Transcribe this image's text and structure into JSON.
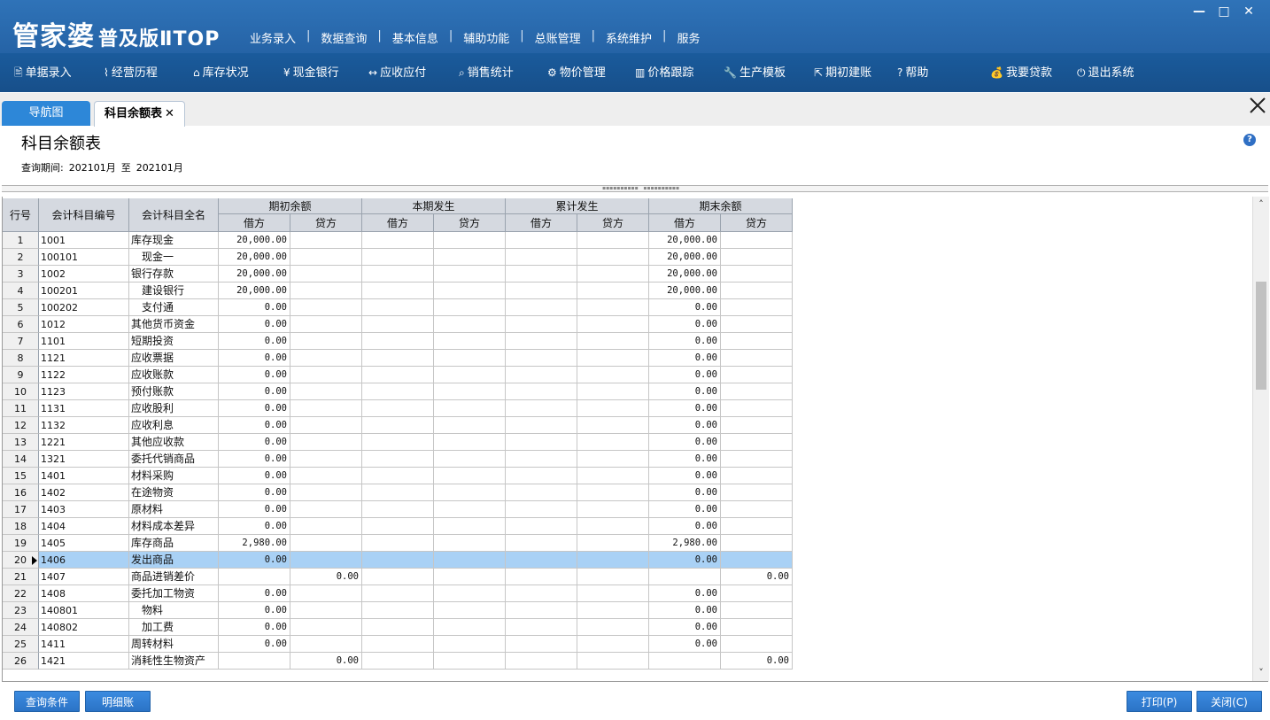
{
  "app": {
    "logo_main": "管家婆",
    "logo_sub": "普及版ⅡTOP"
  },
  "top_menu": [
    "业务录入",
    "数据查询",
    "基本信息",
    "辅助功能",
    "总账管理",
    "系统维护",
    "服务"
  ],
  "window_controls": {
    "minimize": "—",
    "maximize": "□",
    "close": "✕"
  },
  "toolbar": [
    {
      "icon": "document-icon",
      "glyph": "🖹",
      "label": "单据录入"
    },
    {
      "icon": "chart-line-icon",
      "glyph": "⌇",
      "label": "经营历程"
    },
    {
      "icon": "warehouse-icon",
      "glyph": "⌂",
      "label": "库存状况"
    },
    {
      "icon": "yen-icon",
      "glyph": "¥",
      "label": "现金银行"
    },
    {
      "icon": "arrows-icon",
      "glyph": "↔",
      "label": "应收应付"
    },
    {
      "icon": "search-icon",
      "glyph": "⌕",
      "label": "销售统计"
    },
    {
      "icon": "gear-icon",
      "glyph": "⚙",
      "label": "物价管理"
    },
    {
      "icon": "bar-chart-icon",
      "glyph": "▥",
      "label": "价格跟踪"
    },
    {
      "icon": "wrench-icon",
      "glyph": "🔧",
      "label": "生产模板"
    },
    {
      "icon": "export-icon",
      "glyph": "⇱",
      "label": "期初建账"
    },
    {
      "icon": "help-icon",
      "glyph": "?",
      "label": "帮助"
    },
    {
      "icon": "money-bag-icon",
      "glyph": "💰",
      "label": "我要贷款"
    },
    {
      "icon": "power-icon",
      "glyph": "⏻",
      "label": "退出系统"
    }
  ],
  "tabs": {
    "nav": "导航图",
    "current": "科目余额表",
    "close_glyph": "✕"
  },
  "page": {
    "title": "科目余额表",
    "period_label": "查询期间:",
    "period_from": "202101月",
    "period_to_word": "至",
    "period_to": "202101月",
    "help_glyph": "?"
  },
  "grid": {
    "headers": {
      "row_no": "行号",
      "code": "会计科目编号",
      "name": "会计科目全名",
      "groups": [
        "期初余额",
        "本期发生",
        "累计发生",
        "期末余额"
      ],
      "debit": "借方",
      "credit": "贷方"
    },
    "selected_row": 19,
    "rows": [
      {
        "no": "1",
        "code": "1001",
        "name": "库存现金",
        "ob_d": "20,000.00",
        "ob_c": "",
        "cp_d": "",
        "cp_c": "",
        "cu_d": "",
        "cu_c": "",
        "eb_d": "20,000.00",
        "eb_c": ""
      },
      {
        "no": "2",
        "code": "100101",
        "name": "　现金一",
        "ob_d": "20,000.00",
        "ob_c": "",
        "cp_d": "",
        "cp_c": "",
        "cu_d": "",
        "cu_c": "",
        "eb_d": "20,000.00",
        "eb_c": ""
      },
      {
        "no": "3",
        "code": "1002",
        "name": "银行存款",
        "ob_d": "20,000.00",
        "ob_c": "",
        "cp_d": "",
        "cp_c": "",
        "cu_d": "",
        "cu_c": "",
        "eb_d": "20,000.00",
        "eb_c": ""
      },
      {
        "no": "4",
        "code": "100201",
        "name": "　建设银行",
        "ob_d": "20,000.00",
        "ob_c": "",
        "cp_d": "",
        "cp_c": "",
        "cu_d": "",
        "cu_c": "",
        "eb_d": "20,000.00",
        "eb_c": ""
      },
      {
        "no": "5",
        "code": "100202",
        "name": "　支付通",
        "ob_d": "0.00",
        "ob_c": "",
        "cp_d": "",
        "cp_c": "",
        "cu_d": "",
        "cu_c": "",
        "eb_d": "0.00",
        "eb_c": ""
      },
      {
        "no": "6",
        "code": "1012",
        "name": "其他货币资金",
        "ob_d": "0.00",
        "ob_c": "",
        "cp_d": "",
        "cp_c": "",
        "cu_d": "",
        "cu_c": "",
        "eb_d": "0.00",
        "eb_c": ""
      },
      {
        "no": "7",
        "code": "1101",
        "name": "短期投资",
        "ob_d": "0.00",
        "ob_c": "",
        "cp_d": "",
        "cp_c": "",
        "cu_d": "",
        "cu_c": "",
        "eb_d": "0.00",
        "eb_c": ""
      },
      {
        "no": "8",
        "code": "1121",
        "name": "应收票据",
        "ob_d": "0.00",
        "ob_c": "",
        "cp_d": "",
        "cp_c": "",
        "cu_d": "",
        "cu_c": "",
        "eb_d": "0.00",
        "eb_c": ""
      },
      {
        "no": "9",
        "code": "1122",
        "name": "应收账款",
        "ob_d": "0.00",
        "ob_c": "",
        "cp_d": "",
        "cp_c": "",
        "cu_d": "",
        "cu_c": "",
        "eb_d": "0.00",
        "eb_c": ""
      },
      {
        "no": "10",
        "code": "1123",
        "name": "预付账款",
        "ob_d": "0.00",
        "ob_c": "",
        "cp_d": "",
        "cp_c": "",
        "cu_d": "",
        "cu_c": "",
        "eb_d": "0.00",
        "eb_c": ""
      },
      {
        "no": "11",
        "code": "1131",
        "name": "应收股利",
        "ob_d": "0.00",
        "ob_c": "",
        "cp_d": "",
        "cp_c": "",
        "cu_d": "",
        "cu_c": "",
        "eb_d": "0.00",
        "eb_c": ""
      },
      {
        "no": "12",
        "code": "1132",
        "name": "应收利息",
        "ob_d": "0.00",
        "ob_c": "",
        "cp_d": "",
        "cp_c": "",
        "cu_d": "",
        "cu_c": "",
        "eb_d": "0.00",
        "eb_c": ""
      },
      {
        "no": "13",
        "code": "1221",
        "name": "其他应收款",
        "ob_d": "0.00",
        "ob_c": "",
        "cp_d": "",
        "cp_c": "",
        "cu_d": "",
        "cu_c": "",
        "eb_d": "0.00",
        "eb_c": ""
      },
      {
        "no": "14",
        "code": "1321",
        "name": "委托代销商品",
        "ob_d": "0.00",
        "ob_c": "",
        "cp_d": "",
        "cp_c": "",
        "cu_d": "",
        "cu_c": "",
        "eb_d": "0.00",
        "eb_c": ""
      },
      {
        "no": "15",
        "code": "1401",
        "name": "材料采购",
        "ob_d": "0.00",
        "ob_c": "",
        "cp_d": "",
        "cp_c": "",
        "cu_d": "",
        "cu_c": "",
        "eb_d": "0.00",
        "eb_c": ""
      },
      {
        "no": "16",
        "code": "1402",
        "name": "在途物资",
        "ob_d": "0.00",
        "ob_c": "",
        "cp_d": "",
        "cp_c": "",
        "cu_d": "",
        "cu_c": "",
        "eb_d": "0.00",
        "eb_c": ""
      },
      {
        "no": "17",
        "code": "1403",
        "name": "原材料",
        "ob_d": "0.00",
        "ob_c": "",
        "cp_d": "",
        "cp_c": "",
        "cu_d": "",
        "cu_c": "",
        "eb_d": "0.00",
        "eb_c": ""
      },
      {
        "no": "18",
        "code": "1404",
        "name": "材料成本差异",
        "ob_d": "0.00",
        "ob_c": "",
        "cp_d": "",
        "cp_c": "",
        "cu_d": "",
        "cu_c": "",
        "eb_d": "0.00",
        "eb_c": ""
      },
      {
        "no": "19",
        "code": "1405",
        "name": "库存商品",
        "ob_d": "2,980.00",
        "ob_c": "",
        "cp_d": "",
        "cp_c": "",
        "cu_d": "",
        "cu_c": "",
        "eb_d": "2,980.00",
        "eb_c": ""
      },
      {
        "no": "20",
        "code": "1406",
        "name": "发出商品",
        "ob_d": "0.00",
        "ob_c": "",
        "cp_d": "",
        "cp_c": "",
        "cu_d": "",
        "cu_c": "",
        "eb_d": "0.00",
        "eb_c": ""
      },
      {
        "no": "21",
        "code": "1407",
        "name": "商品进销差价",
        "ob_d": "",
        "ob_c": "0.00",
        "cp_d": "",
        "cp_c": "",
        "cu_d": "",
        "cu_c": "",
        "eb_d": "",
        "eb_c": "0.00"
      },
      {
        "no": "22",
        "code": "1408",
        "name": "委托加工物资",
        "ob_d": "0.00",
        "ob_c": "",
        "cp_d": "",
        "cp_c": "",
        "cu_d": "",
        "cu_c": "",
        "eb_d": "0.00",
        "eb_c": ""
      },
      {
        "no": "23",
        "code": "140801",
        "name": "　物料",
        "ob_d": "0.00",
        "ob_c": "",
        "cp_d": "",
        "cp_c": "",
        "cu_d": "",
        "cu_c": "",
        "eb_d": "0.00",
        "eb_c": ""
      },
      {
        "no": "24",
        "code": "140802",
        "name": "　加工费",
        "ob_d": "0.00",
        "ob_c": "",
        "cp_d": "",
        "cp_c": "",
        "cu_d": "",
        "cu_c": "",
        "eb_d": "0.00",
        "eb_c": ""
      },
      {
        "no": "25",
        "code": "1411",
        "name": "周转材料",
        "ob_d": "0.00",
        "ob_c": "",
        "cp_d": "",
        "cp_c": "",
        "cu_d": "",
        "cu_c": "",
        "eb_d": "0.00",
        "eb_c": ""
      },
      {
        "no": "26",
        "code": "1421",
        "name": "消耗性生物资产",
        "ob_d": "",
        "ob_c": "0.00",
        "cp_d": "",
        "cp_c": "",
        "cu_d": "",
        "cu_c": "",
        "eb_d": "",
        "eb_c": "0.00"
      }
    ]
  },
  "scrollbar": {
    "up": "˄",
    "down": "˅",
    "position": 0.2
  },
  "buttons": {
    "query": "查询条件",
    "detail": "明细账",
    "print": "打印(P)",
    "close": "关闭(C)"
  },
  "colors": {
    "title_bar": "#2563a6",
    "toolbar": "#174f8a",
    "tab_active": "#2d87d8",
    "selected_row": "#a9d1f5",
    "button": "#2b73c6"
  }
}
